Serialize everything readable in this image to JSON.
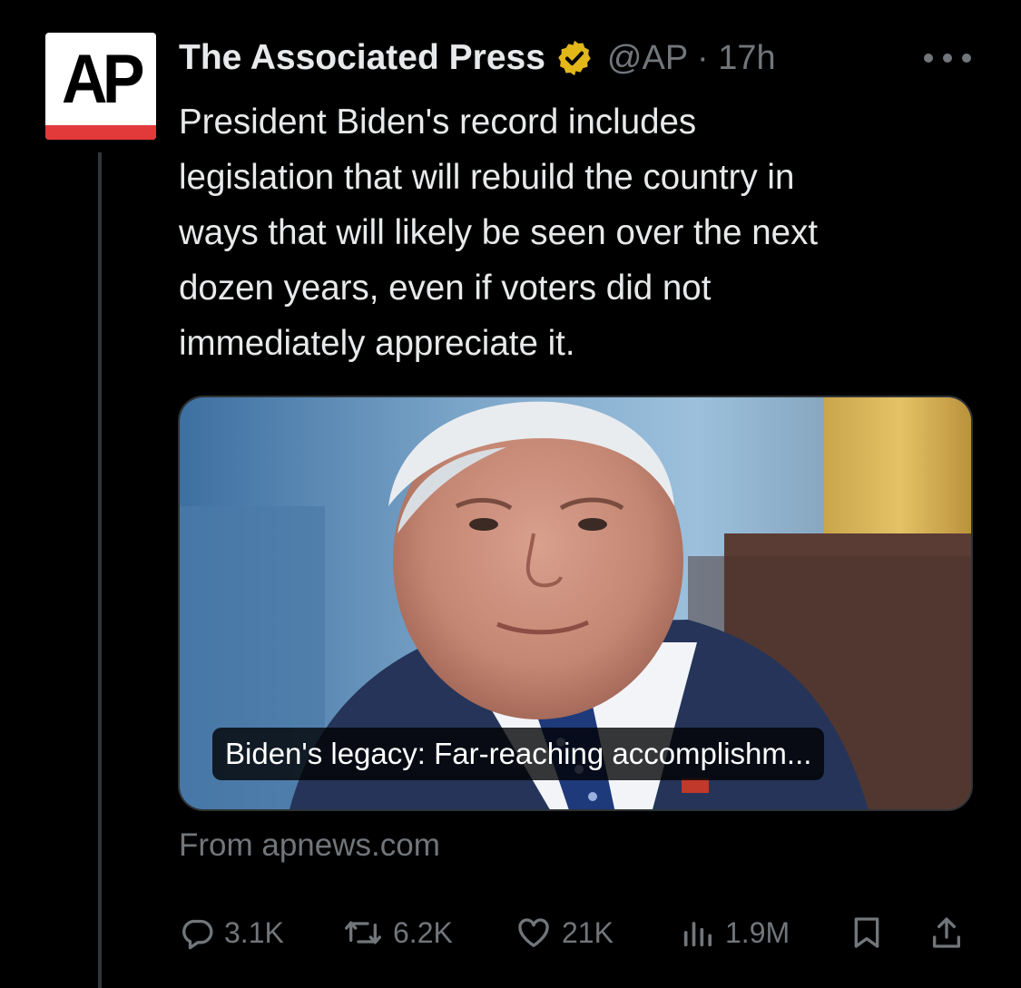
{
  "tweet": {
    "author_name": "The Associated Press",
    "handle_time": "@AP · 17h",
    "avatar_text": "AP",
    "text": "President Biden's record includes\nlegislation that will rebuild the country in\nways that will likely be seen over the next\ndozen years, even if voters did not\nimmediately appreciate it.",
    "card": {
      "title": "Biden's legacy: Far-reaching accomplishm...",
      "source": "From apnews.com"
    },
    "stats": {
      "replies": "3.1K",
      "reposts": "6.2K",
      "likes": "21K",
      "views": "1.9M"
    }
  },
  "icons": {
    "verified": "verified-gold-badge-icon",
    "more": "more-options-icon",
    "reply": "reply-icon",
    "repost": "repost-icon",
    "like": "like-icon",
    "views": "views-icon",
    "bookmark": "bookmark-icon",
    "share": "share-icon"
  },
  "colors": {
    "background": "#000000",
    "text": "#e7e9ea",
    "muted": "#71767b",
    "verified_gold": "#e2b719",
    "ap_red": "#e2393a"
  }
}
